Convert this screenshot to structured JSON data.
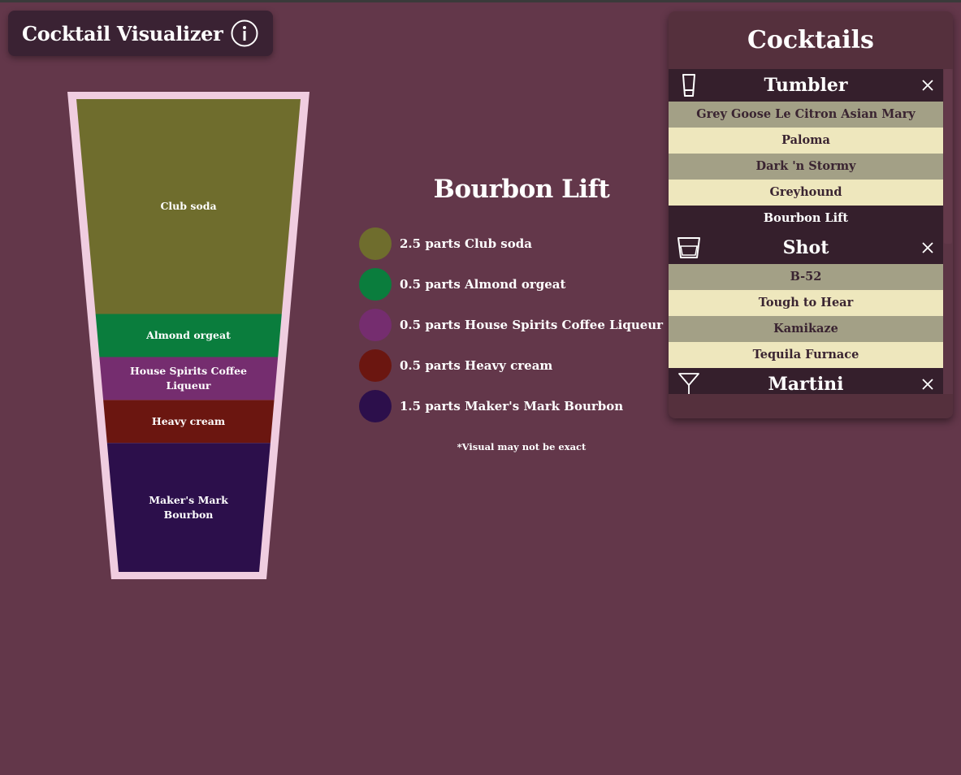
{
  "header": {
    "title": "Cocktail Visualizer",
    "info_icon": "info-circle-icon"
  },
  "glass": {
    "layers": [
      {
        "label": "Club soda",
        "parts": 2.5,
        "color": "#6f6d2d"
      },
      {
        "label": "Almond orgeat",
        "parts": 0.5,
        "color": "#0a7d3d"
      },
      {
        "label": "House Spirits Coffee Liqueur",
        "parts": 0.5,
        "color": "#752d6f"
      },
      {
        "label": "Heavy cream",
        "parts": 0.5,
        "color": "#6b1610"
      },
      {
        "label": "Maker's Mark Bourbon",
        "parts": 1.5,
        "color": "#2c0f4b"
      }
    ],
    "rim_color": "#f0cde0"
  },
  "recipe": {
    "name": "Bourbon Lift",
    "ingredients": [
      {
        "text": "2.5 parts Club soda",
        "color": "#6f6d2d"
      },
      {
        "text": "0.5 parts Almond orgeat",
        "color": "#0a7d3d"
      },
      {
        "text": "0.5 parts House Spirits Coffee Liqueur",
        "color": "#752d6f"
      },
      {
        "text": "0.5 parts Heavy cream",
        "color": "#6b1610"
      },
      {
        "text": "1.5 parts Maker's Mark Bourbon",
        "color": "#2c0f4b"
      }
    ],
    "disclaimer": "*Visual may not be exact"
  },
  "panel": {
    "title": "Cocktails",
    "groups": [
      {
        "name": "Tumbler",
        "icon": "tumbler-glass-icon",
        "drinks": [
          "Grey Goose Le Citron Asian Mary",
          "Paloma",
          "Dark 'n Stormy",
          "Greyhound",
          "Bourbon Lift"
        ],
        "active": "Bourbon Lift"
      },
      {
        "name": "Shot",
        "icon": "shot-glass-icon",
        "drinks": [
          "B-52",
          "Tough to Hear",
          "Kamikaze",
          "Tequila Furnace"
        ]
      },
      {
        "name": "Martini",
        "icon": "martini-glass-icon",
        "drinks": []
      }
    ]
  },
  "colors": {
    "background": "#63374a",
    "panel": "#55303d",
    "group_header": "#351f2c",
    "row_odd": "#a3a086",
    "row_even": "#eee7bd"
  }
}
